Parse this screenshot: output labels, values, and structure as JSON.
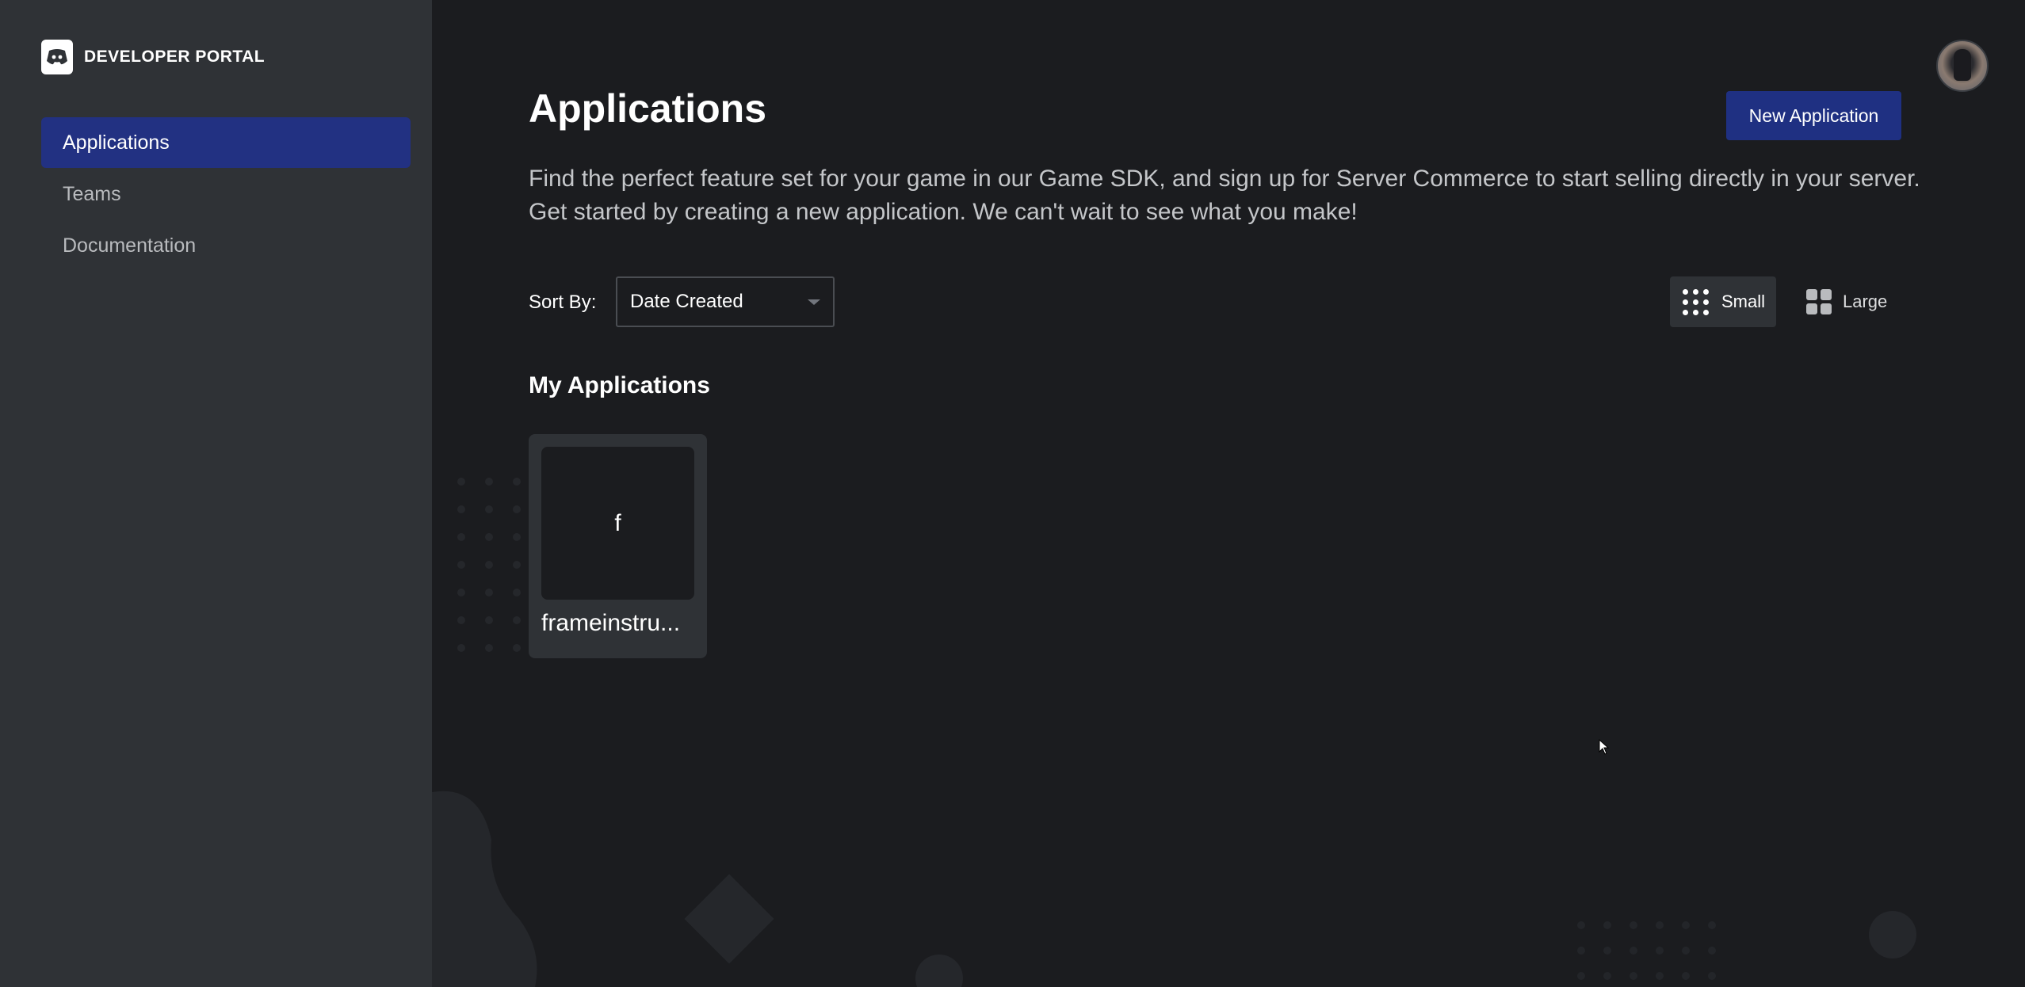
{
  "brand": {
    "name": "DEVELOPER PORTAL",
    "logo_icon": "discord-logo-icon"
  },
  "sidebar": {
    "items": [
      {
        "label": "Applications",
        "active": true
      },
      {
        "label": "Teams",
        "active": false
      },
      {
        "label": "Documentation",
        "active": false
      }
    ]
  },
  "header": {
    "title": "Applications",
    "new_app_label": "New Application",
    "description": "Find the perfect feature set for your game in our Game SDK, and sign up for Server Commerce to start selling directly in your server. Get started by creating a new application. We can't wait to see what you make!"
  },
  "sort": {
    "label": "Sort By:",
    "selected": "Date Created"
  },
  "view_toggle": {
    "small_label": "Small",
    "large_label": "Large",
    "selected": "Small"
  },
  "my_apps": {
    "title": "My Applications",
    "apps": [
      {
        "initial": "f",
        "name": "frameinstru..."
      }
    ]
  },
  "colors": {
    "sidebar_bg": "#2f3236",
    "main_bg": "#1b1c1f",
    "accent": "#223182"
  }
}
